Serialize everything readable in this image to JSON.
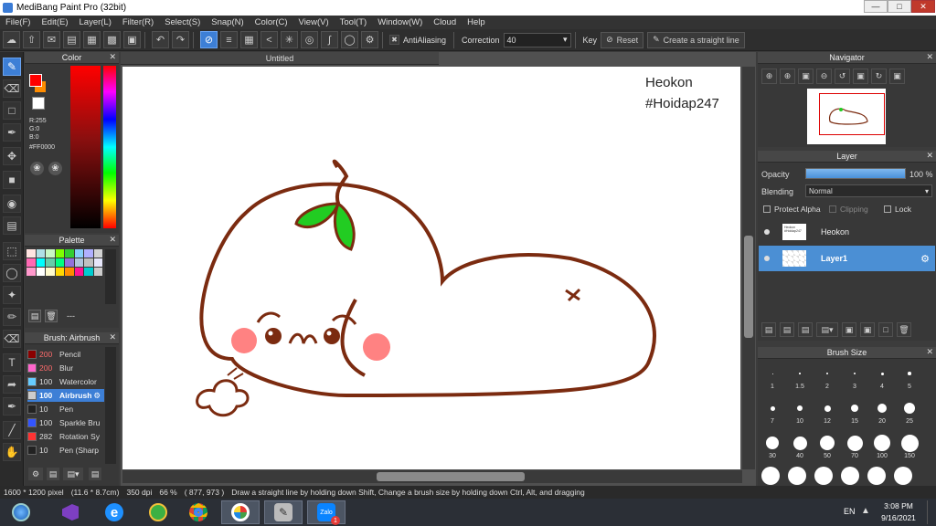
{
  "window": {
    "title": "MediBang Paint Pro (32bit)"
  },
  "menu": [
    "File(F)",
    "Edit(E)",
    "Layer(L)",
    "Filter(R)",
    "Select(S)",
    "Snap(N)",
    "Color(C)",
    "View(V)",
    "Tool(T)",
    "Window(W)",
    "Cloud",
    "Help"
  ],
  "toolbar": {
    "antialiasing_label": "AntiAliasing",
    "correction_label": "Correction",
    "correction_value": "40",
    "key_label": "Key",
    "reset_label": "Reset",
    "straight_line_label": "Create a straight line"
  },
  "color_panel": {
    "title": "Color",
    "r": "R:255",
    "g": "G:0",
    "b": "B:0",
    "hex": "#FF0000",
    "fg_color": "#ff0000",
    "secondary_color": "#ff8c00"
  },
  "palette_panel": {
    "title": "Palette",
    "dash": "---",
    "colors": [
      "#ffe4e1",
      "#b0e0e6",
      "#c8f7c5",
      "#7fff00",
      "#32cd32",
      "#87cefa",
      "#b0b0ff",
      "#d3d3d3",
      "#ff69b4",
      "#00ffff",
      "#66cdaa",
      "#00ff7f",
      "#9370db",
      "#b0c4de",
      "#c0c0c0",
      "#e6e6fa",
      "#ff99cc",
      "#ffffff",
      "#fffacd",
      "#ffd700",
      "#ff8c00",
      "#ff1493",
      "#00ced1",
      "#cccccc"
    ]
  },
  "brush_panel": {
    "title": "Brush: Airbrush",
    "items": [
      {
        "size": "200",
        "name": "Pencil",
        "color": "#8b0000"
      },
      {
        "size": "200",
        "name": "Blur",
        "color": "#ff66cc"
      },
      {
        "size": "100",
        "name": "Watercolor",
        "color": "#66ccff"
      },
      {
        "size": "100",
        "name": "Airbrush",
        "color": "#cccccc"
      },
      {
        "size": "10",
        "name": "Pen",
        "color": "#222222"
      },
      {
        "size": "100",
        "name": "Sparkle Bru",
        "color": "#3355ff"
      },
      {
        "size": "282",
        "name": "Rotation Sy",
        "color": "#ff3333"
      },
      {
        "size": "10",
        "name": "Pen (Sharp",
        "color": "#222222"
      }
    ]
  },
  "document": {
    "tab_title": "Untitled"
  },
  "canvas": {
    "text_line1": "Heokon",
    "text_line2": "#Hoidap247"
  },
  "navigator": {
    "title": "Navigator"
  },
  "layer_panel": {
    "title": "Layer",
    "opacity_label": "Opacity",
    "opacity_value": "100 %",
    "blending_label": "Blending",
    "blending_value": "Normal",
    "protect_alpha": "Protect Alpha",
    "clipping": "Clipping",
    "lock": "Lock",
    "layers": [
      {
        "name": "Heokon",
        "thumb_text": "Heokon\n#Hoidap247"
      },
      {
        "name": "Layer1"
      }
    ]
  },
  "brush_size_panel": {
    "title": "Brush Size",
    "sizes": [
      "1",
      "1.5",
      "2",
      "3",
      "4",
      "5",
      "7",
      "10",
      "12",
      "15",
      "20",
      "25",
      "30",
      "40",
      "50",
      "70",
      "100",
      "150"
    ]
  },
  "status": {
    "dimensions": "1600 * 1200 pixel",
    "physical": "(11.6 * 8.7cm)",
    "dpi": "350 dpi",
    "zoom": "66 %",
    "coords": "( 877, 973 )",
    "hint": "Draw a straight line by holding down Shift, Change a brush size by holding down Ctrl, Alt, and dragging"
  },
  "taskbar": {
    "lang": "EN",
    "time": "3:08 PM",
    "date": "9/16/2021",
    "zalo_badge": "1"
  }
}
